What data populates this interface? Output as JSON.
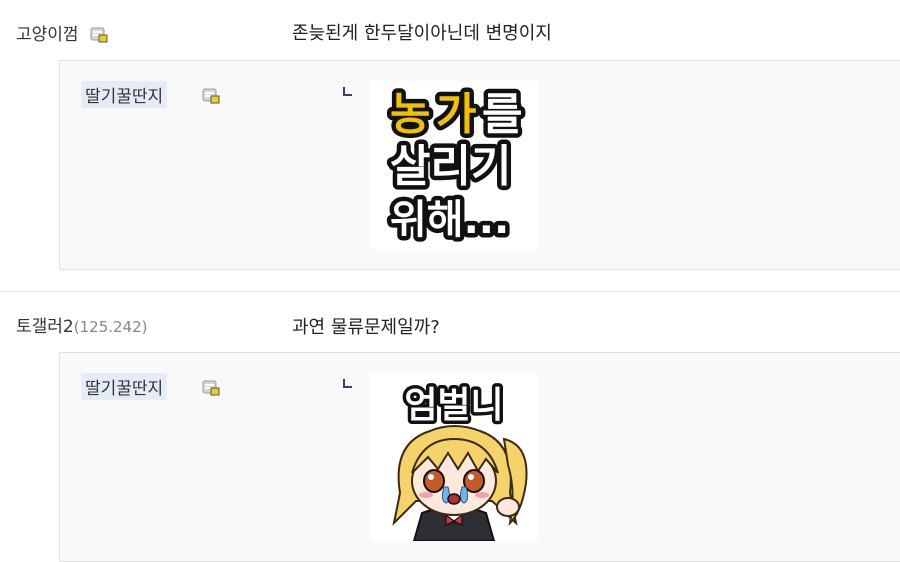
{
  "comments": [
    {
      "author": "고양이껌",
      "text": "존늦된게 한두달이아닌데 변명이지",
      "reply": {
        "author": "딸기꿀딴지",
        "dccon_text": "농가를 살리기 위해..."
      }
    },
    {
      "author": "토갤러2",
      "ip": "(125.242)",
      "text": "과연 물류문제일까?",
      "reply": {
        "author": "딸기꿀딴지",
        "dccon_text": "엄벌니"
      }
    }
  ],
  "dccon1": {
    "line1_a": "농",
    "line1_b": "가",
    "line1_c": "를",
    "line2": "살리기",
    "line3": "위해..."
  },
  "dccon2": {
    "caption": "엄벌니"
  },
  "icons": {
    "gallog": "gallog-icon",
    "reply_arrow": "reply-corner-icon"
  },
  "colors": {
    "reply_bg": "#f9f9f9",
    "nick_highlight": "#e6ecf7",
    "icon_yellow": "#e8d21a",
    "dccon_yellow": "#f2c200"
  }
}
